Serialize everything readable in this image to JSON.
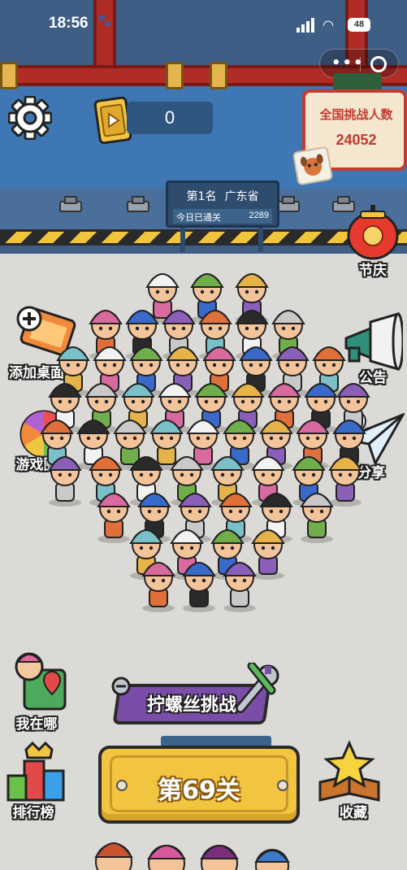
{
  "status_bar": {
    "time": "18:56",
    "battery": "48"
  },
  "header": {
    "ticket_count": "0",
    "national_board_title": "全国挑战人数",
    "national_board_count": "24052"
  },
  "rank_sign": {
    "rank": "第1名",
    "region": "广东省",
    "today_label": "今日已通关",
    "today_count": "2289"
  },
  "side_left": [
    {
      "label": "添加桌面",
      "icon": "add-desktop-icon"
    },
    {
      "label": "游戏圈",
      "icon": "game-circle-icon"
    },
    {
      "label": "我在哪",
      "icon": "where-am-i-icon"
    },
    {
      "label": "排行榜",
      "icon": "leaderboard-icon"
    }
  ],
  "side_right": [
    {
      "label": "节庆",
      "icon": "lantern-icon"
    },
    {
      "label": "公告",
      "icon": "megaphone-icon"
    },
    {
      "label": "分享",
      "icon": "paper-plane-icon"
    },
    {
      "label": "收藏",
      "icon": "star-book-icon"
    }
  ],
  "challenge_banner": "拧螺丝挑战",
  "level_button": "第69关",
  "colors": {
    "machine_blue": "#3e77b3",
    "pipe_red": "#b02c27",
    "button_yellow": "#f2c540",
    "challenge_purple": "#7a4ea8",
    "board_red": "#c6392e"
  }
}
